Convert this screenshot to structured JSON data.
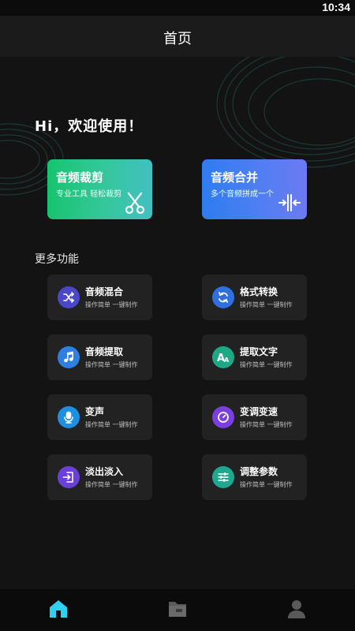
{
  "status_bar": {
    "time": "10:34"
  },
  "header": {
    "title": "首页"
  },
  "greeting": "Hi，欢迎使用！",
  "feature_cards": [
    {
      "title": "音频裁剪",
      "subtitle": "专业工具  轻松裁剪",
      "icon": "scissors-icon",
      "gradient": [
        "#17c36e",
        "#42c0c2"
      ]
    },
    {
      "title": "音频合并",
      "subtitle": "多个音频拼成一个",
      "icon": "merge-icon",
      "gradient": [
        "#2e7cf0",
        "#6d7af2"
      ]
    }
  ],
  "more_section": {
    "title": "更多功能",
    "items": [
      {
        "name": "音频混合",
        "subtitle": "操作简单  一键制作",
        "icon": "shuffle-icon",
        "color": "#4a48c8"
      },
      {
        "name": "格式转换",
        "subtitle": "操作简单  一键制作",
        "icon": "refresh-icon",
        "color": "#2f6fe0"
      },
      {
        "name": "音频提取",
        "subtitle": "操作简单  一键制作",
        "icon": "music-note-icon",
        "color": "#2f7fe0"
      },
      {
        "name": "提取文字",
        "subtitle": "操作简单  一键制作",
        "icon": "text-extract-icon",
        "color": "#1fa886"
      },
      {
        "name": "变声",
        "subtitle": "操作简单  一键制作",
        "icon": "microphone-icon",
        "color": "#1f8fe0"
      },
      {
        "name": "变调变速",
        "subtitle": "操作简单  一键制作",
        "icon": "speed-icon",
        "color": "#7b3fe0"
      },
      {
        "name": "淡出淡入",
        "subtitle": "操作简单  一键制作",
        "icon": "fade-in-icon",
        "color": "#6a40d8"
      },
      {
        "name": "调整参数",
        "subtitle": "操作简单  一键制作",
        "icon": "sliders-icon",
        "color": "#1fa890"
      }
    ]
  },
  "bottom_nav": [
    {
      "icon": "home-icon",
      "active": true,
      "color": "#2fd0f0"
    },
    {
      "icon": "folder-icon",
      "active": false,
      "color": "#5a5a5a"
    },
    {
      "icon": "profile-icon",
      "active": false,
      "color": "#5a5a5a"
    }
  ]
}
